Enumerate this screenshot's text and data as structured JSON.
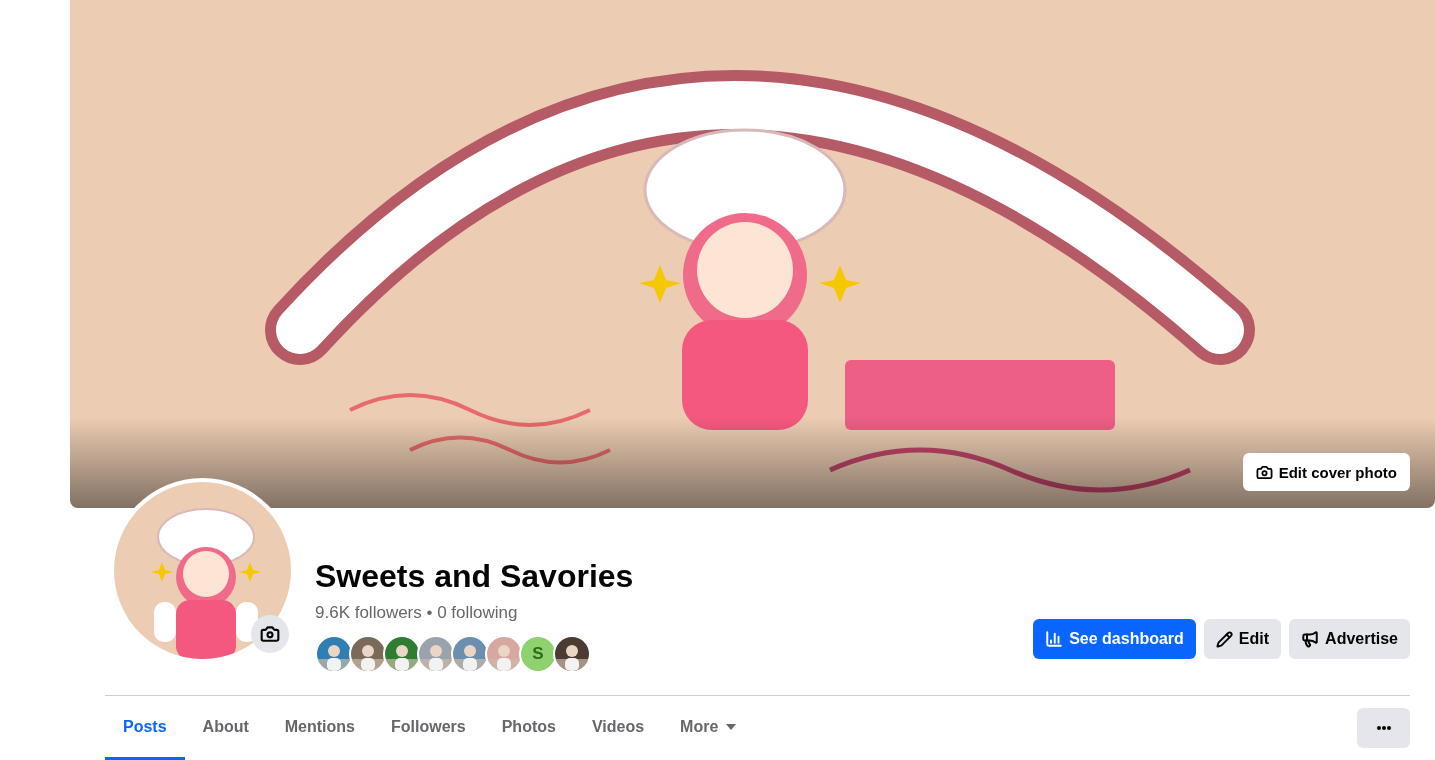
{
  "cover": {
    "kind": "picture",
    "edit_button": "Edit cover photo"
  },
  "profile": {
    "kind": "picture",
    "name": "Sweets and Savories",
    "stats": "9.6K followers • 0 following"
  },
  "follower_avatars": [
    {
      "kind": "picture"
    },
    {
      "kind": "picture"
    },
    {
      "kind": "picture"
    },
    {
      "kind": "picture"
    },
    {
      "kind": "picture"
    },
    {
      "kind": "picture"
    },
    {
      "kind": "letter",
      "letter": "S",
      "color": "#8fd16f"
    },
    {
      "kind": "picture"
    }
  ],
  "actions": [
    {
      "label": "See dashboard",
      "kind": "primary"
    },
    {
      "label": "Edit",
      "kind": "secondary"
    },
    {
      "label": "Advertise",
      "kind": "secondary"
    }
  ],
  "tabs": [
    {
      "label": "Posts",
      "selected": true
    },
    {
      "label": "About",
      "selected": false
    },
    {
      "label": "Mentions",
      "selected": false
    },
    {
      "label": "Followers",
      "selected": false
    },
    {
      "label": "Photos",
      "selected": false
    },
    {
      "label": "Videos",
      "selected": false
    },
    {
      "label": "More",
      "selected": false,
      "dropdown": true
    }
  ]
}
